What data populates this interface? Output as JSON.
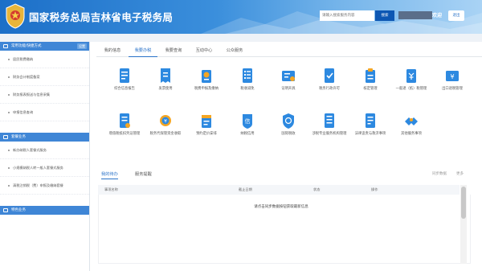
{
  "header": {
    "title": "国家税务总局吉林省电子税务局",
    "search_placeholder": "请输入搜索服务内容",
    "search_button": "搜索",
    "welcome": "欢迎",
    "logout_button": "退出"
  },
  "sidebar": {
    "section1": {
      "title": "常用功能/快捷方式",
      "tag": "设置",
      "items": [
        {
          "label": "居民税费缴纳"
        },
        {
          "label": "财务会计制度备案"
        },
        {
          "label": "财务报表报送与信息采集"
        },
        {
          "label": "申报信息查询"
        }
      ]
    },
    "section2": {
      "title": "套餐业务",
      "items": [
        {
          "label": "新办纳税人套餐式服务"
        },
        {
          "label": "小规模纳税人转一般人套餐式服务"
        },
        {
          "label": "清税注销税（费）申报及缴纳套餐"
        }
      ]
    },
    "section3": {
      "title": "特色业务"
    }
  },
  "main": {
    "tabs": [
      {
        "label": "我的信息"
      },
      {
        "label": "我要办税"
      },
      {
        "label": "我要查询"
      },
      {
        "label": "互动中心"
      },
      {
        "label": "公众服务"
      }
    ],
    "apps": [
      {
        "label": "综合信息报告",
        "icon": "info-report-icon"
      },
      {
        "label": "发票使用",
        "icon": "invoice-icon"
      },
      {
        "label": "税费申报及缴纳",
        "icon": "tax-declare-icon"
      },
      {
        "label": "税收减免",
        "icon": "tax-relief-icon"
      },
      {
        "label": "证明开具",
        "icon": "certificate-icon"
      },
      {
        "label": "税务行政许可",
        "icon": "admin-license-icon"
      },
      {
        "label": "核定管理",
        "icon": "approve-icon"
      },
      {
        "label": "一般退（抵）税管理",
        "icon": "tax-refund-icon"
      },
      {
        "label": "出口退税管理",
        "icon": "export-refund-icon"
      },
      {
        "label": "增值税抵扣凭证管理",
        "icon": "vat-voucher-icon"
      },
      {
        "label": "税务代保管资金收取",
        "icon": "escrow-fund-icon"
      },
      {
        "label": "预约定价安排",
        "icon": "pricing-arrangement-icon"
      },
      {
        "label": "纳税信用",
        "icon": "tax-credit-icon"
      },
      {
        "label": "国际税收",
        "icon": "international-tax-icon"
      },
      {
        "label": "涉税专业服务机构管理",
        "icon": "agency-management-icon"
      },
      {
        "label": "法律追责与救济事项",
        "icon": "legal-remedy-icon"
      },
      {
        "label": "其他服务事项",
        "icon": "other-services-icon"
      }
    ],
    "bottom": {
      "tabs": [
        {
          "label": "我的待办"
        },
        {
          "label": "服务提醒"
        }
      ],
      "sync_label": "同步数据",
      "more_label": "更多",
      "columns": [
        "事项名称",
        "截止日期",
        "状态",
        "操作"
      ],
      "empty_message": "请点击同步数据按钮获取最新信息"
    }
  },
  "colors": {
    "header_blue": "#1c6fc8",
    "accent_blue": "#2a73c9",
    "sidebar_header": "#3f86d6",
    "icon_blue": "#2d89e0"
  }
}
